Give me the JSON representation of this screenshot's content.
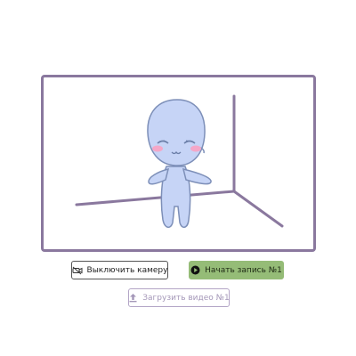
{
  "viewer": {
    "frame_color": "#8a789e",
    "scene": "chibi-character-in-room-corner"
  },
  "controls": {
    "camera_button": {
      "label": "Выключить камеру",
      "icon": "camera-off-icon"
    },
    "record_button": {
      "label": "Начать запись №1",
      "icon": "record-icon",
      "color": "#95bc77"
    },
    "upload_button": {
      "label": "Загрузить видео №1",
      "icon": "upload-icon",
      "state": "disabled"
    }
  }
}
